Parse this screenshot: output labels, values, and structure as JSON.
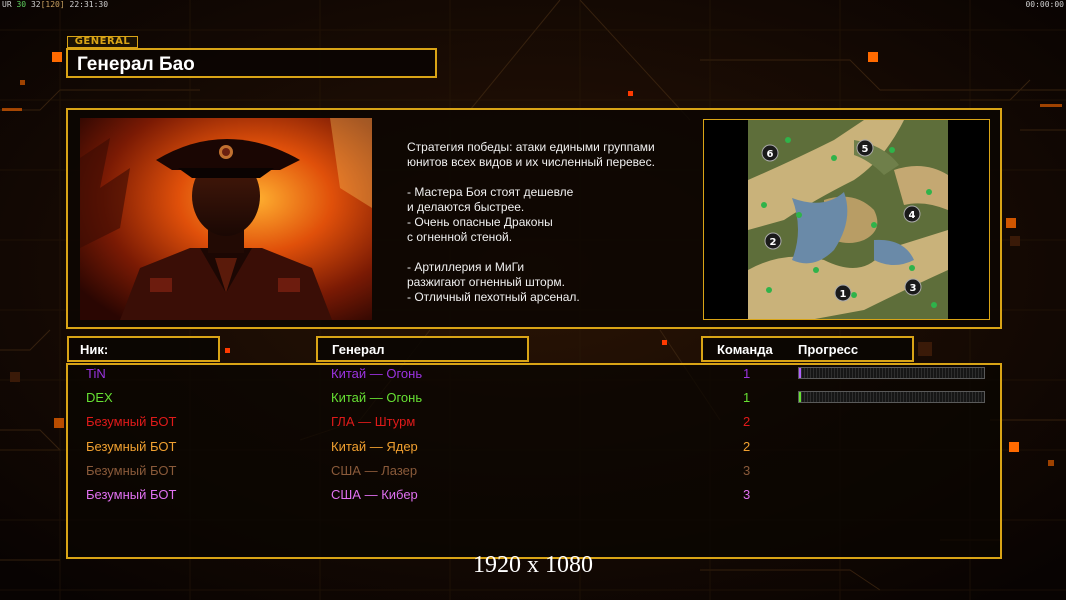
{
  "hud": {
    "left_prefix": "UR",
    "fps": "30",
    "values": "32",
    "frame": "[120]",
    "time": "22:31:30",
    "right_time": "00:00:00"
  },
  "general": {
    "tag": "GENERAL",
    "name": "Генерал Бао"
  },
  "strategy": {
    "lines": [
      "Стратегия победы: атаки едиными группами",
      "юнитов всех видов и их численный перевес.",
      "",
      "- Мастера Боя стоят дешевле",
      "и делаются быстрее.",
      "- Очень опасные Драконы",
      "с огненной стеной.",
      "",
      "- Артиллерия и МиГи",
      "разжигают огненный шторм.",
      "- Отличный пехотный арсенал."
    ]
  },
  "map": {
    "start_positions": [
      "1",
      "2",
      "3",
      "4",
      "5",
      "6"
    ]
  },
  "headers": {
    "nick": "Ник:",
    "general": "Генерал",
    "team": "Команда",
    "progress": "Прогресс"
  },
  "players": [
    {
      "nick": "TiN",
      "general": "Китай — Огонь",
      "team": "1",
      "color": "#9a33e0",
      "progress": 0.01,
      "progress_color": "#b060ff"
    },
    {
      "nick": "DEX",
      "general": "Китай — Огонь",
      "team": "1",
      "color": "#66e033",
      "progress": 0.01,
      "progress_color": "#66e033"
    },
    {
      "nick": "Безумный БОТ",
      "general": "ГЛА — Штурм",
      "team": "2",
      "color": "#e01a1a",
      "progress": null,
      "progress_color": null
    },
    {
      "nick": "Безумный БОТ",
      "general": "Китай — Ядер",
      "team": "2",
      "color": "#f0a030",
      "progress": null,
      "progress_color": null
    },
    {
      "nick": "Безумный БОТ",
      "general": "США — Лазер",
      "team": "3",
      "color": "#8a5a3a",
      "progress": null,
      "progress_color": null
    },
    {
      "nick": "Безумный БОТ",
      "general": "США — Кибер",
      "team": "3",
      "color": "#e070f0",
      "progress": null,
      "progress_color": null
    }
  ],
  "resolution_label": "1920 x 1080"
}
